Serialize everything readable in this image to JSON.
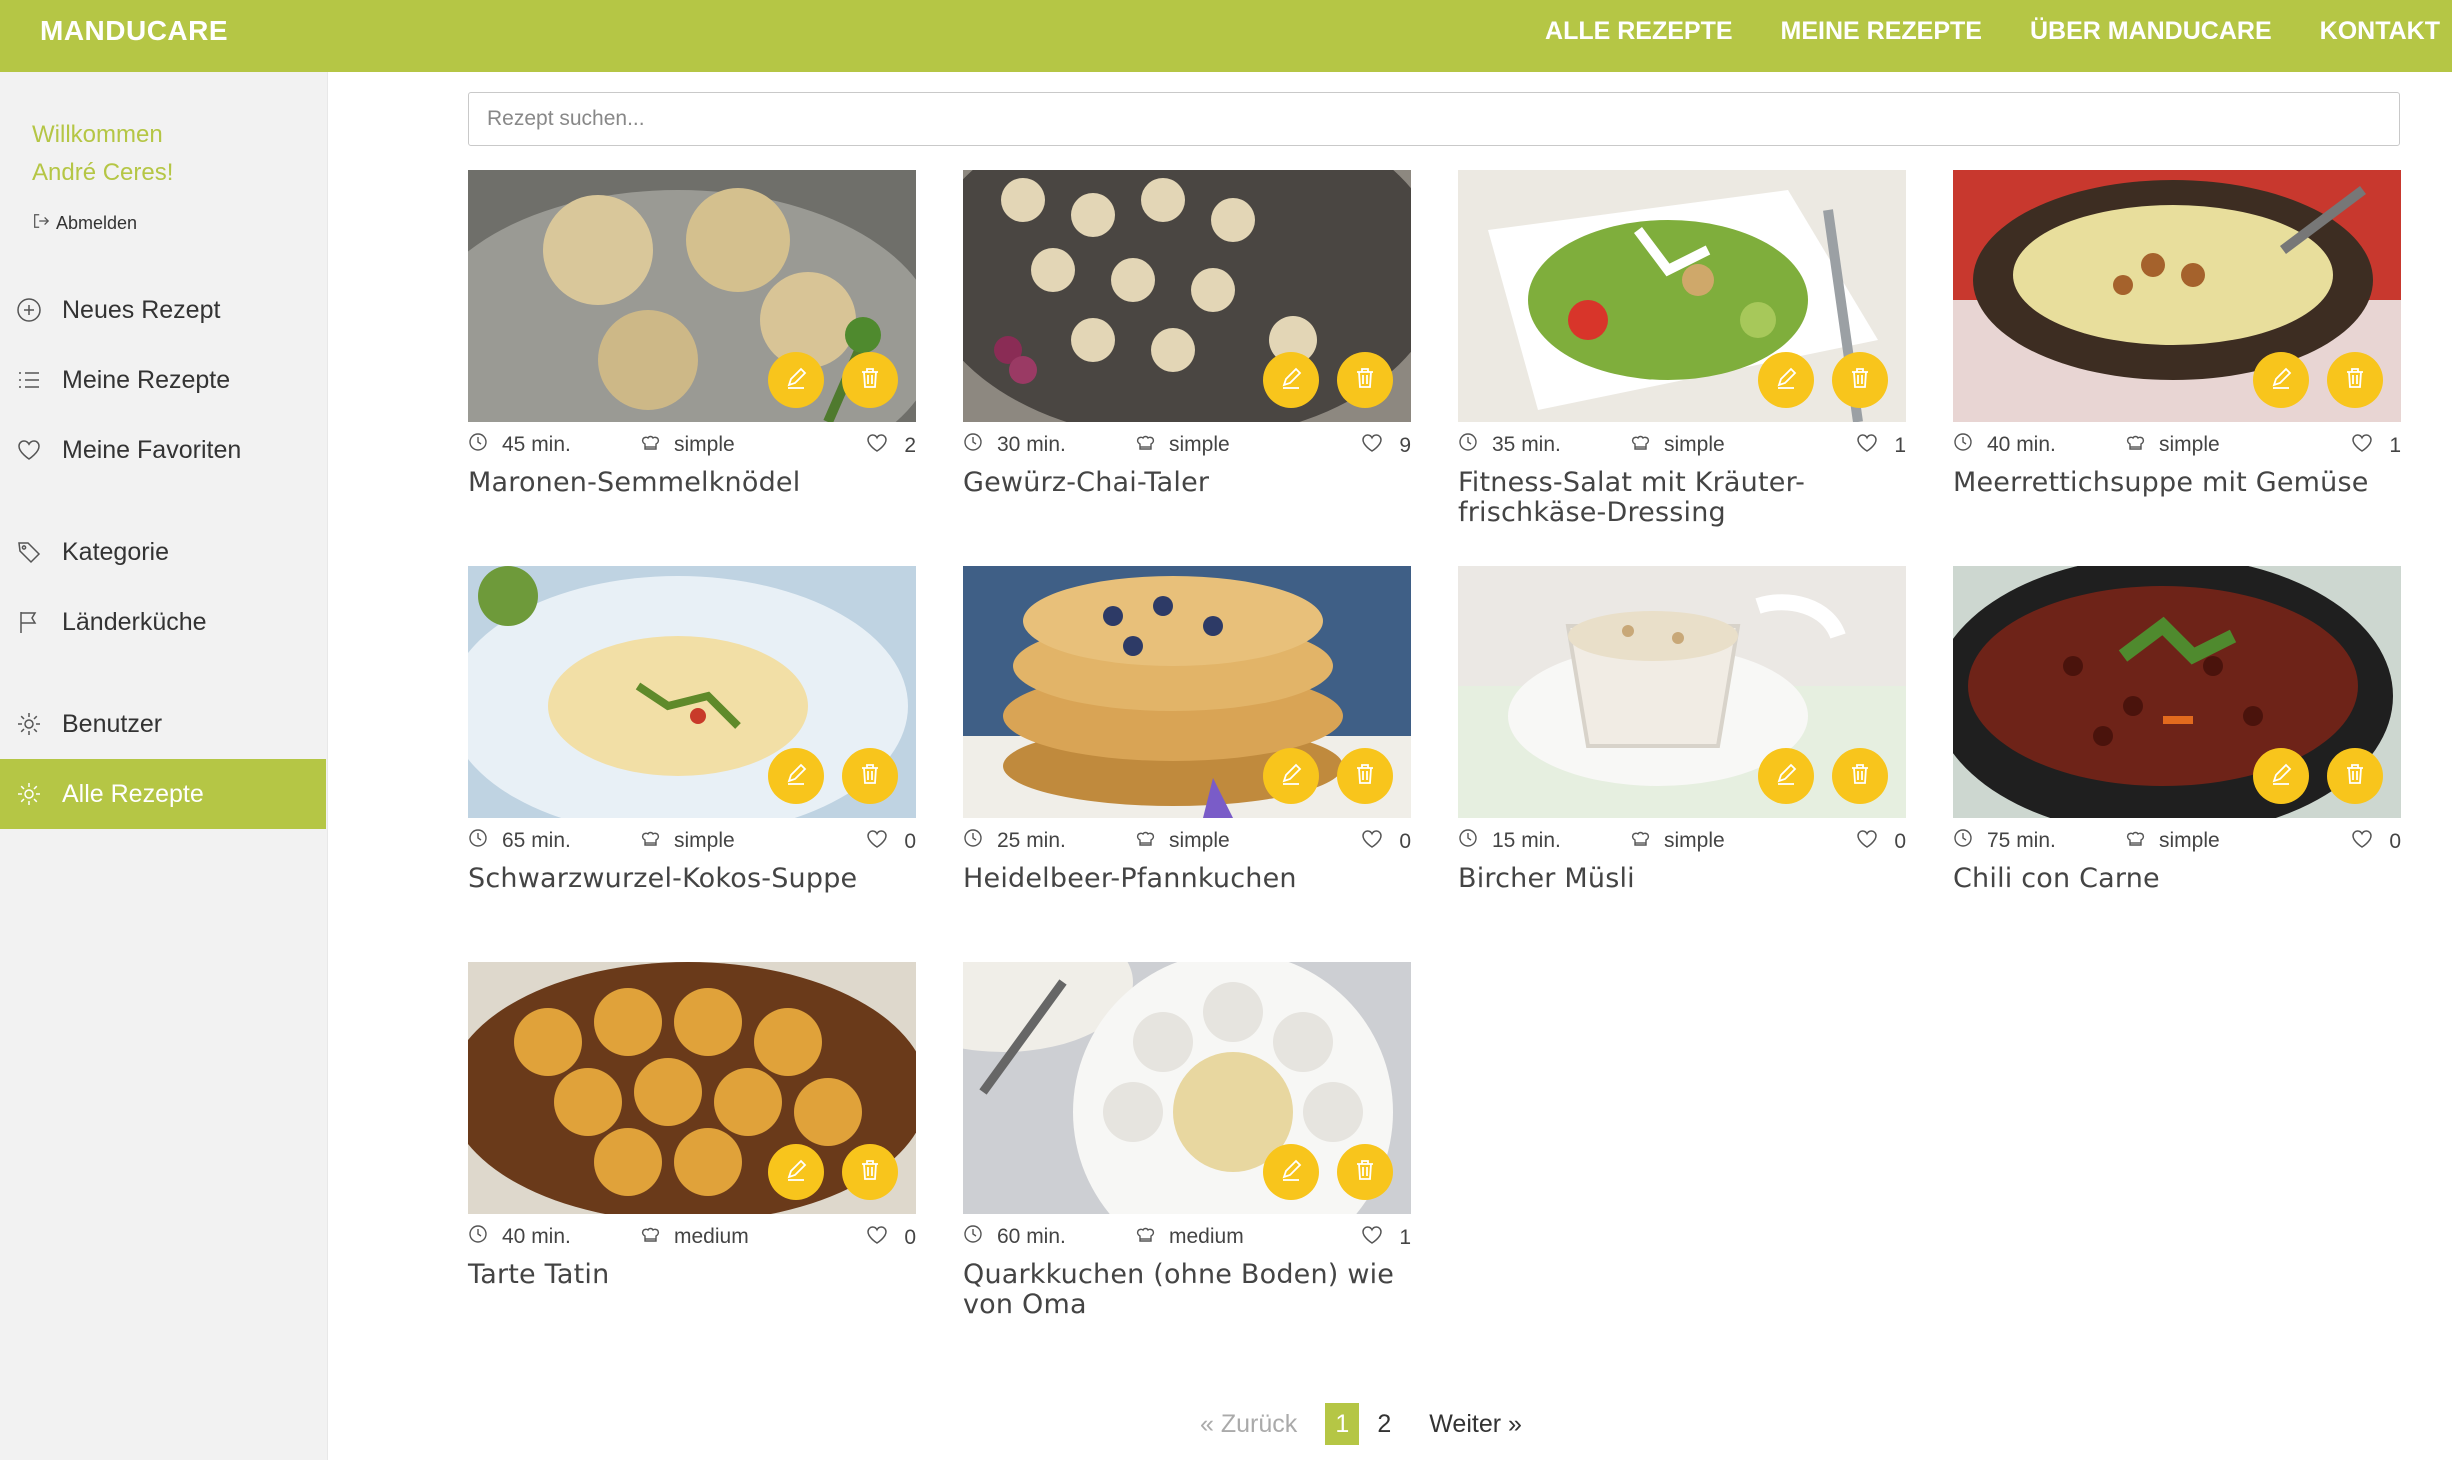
{
  "app": {
    "brand": "MANDUCARE"
  },
  "topnav": [
    {
      "label": "ALLE REZEPTE"
    },
    {
      "label": "MEINE REZEPTE"
    },
    {
      "label": "ÜBER MANDUCARE"
    },
    {
      "label": "KONTAKT"
    }
  ],
  "sidebar": {
    "welcome_line1": "Willkommen",
    "welcome_line2": "André Ceres!",
    "logout": "Abmelden",
    "items": [
      {
        "label": "Neues Rezept",
        "icon": "plus-circle-icon"
      },
      {
        "label": "Meine Rezepte",
        "icon": "list-icon"
      },
      {
        "label": "Meine Favoriten",
        "icon": "heart-icon"
      },
      {
        "label": "Kategorie",
        "icon": "tag-icon"
      },
      {
        "label": "Länderküche",
        "icon": "flag-icon"
      },
      {
        "label": "Benutzer",
        "icon": "gear-icon"
      },
      {
        "label": "Alle Rezepte",
        "icon": "gear-icon",
        "active": true
      }
    ]
  },
  "search": {
    "placeholder": "Rezept suchen..."
  },
  "recipes": [
    {
      "title": "Maronen-Semmelknödel",
      "time": "45 min.",
      "difficulty": "simple",
      "favorites": "2"
    },
    {
      "title": "Gewürz-Chai-Taler",
      "time": "30 min.",
      "difficulty": "simple",
      "favorites": "9"
    },
    {
      "title": "Fitness-Salat mit Kräuter-frischkäse-Dressing",
      "time": "35 min.",
      "difficulty": "simple",
      "favorites": "1"
    },
    {
      "title": "Meerrettichsuppe mit Gemüse",
      "time": "40 min.",
      "difficulty": "simple",
      "favorites": "1"
    },
    {
      "title": "Schwarzwurzel-Kokos-Suppe",
      "time": "65 min.",
      "difficulty": "simple",
      "favorites": "0"
    },
    {
      "title": "Heidelbeer-Pfannkuchen",
      "time": "25 min.",
      "difficulty": "simple",
      "favorites": "0"
    },
    {
      "title": "Bircher Müsli",
      "time": "15 min.",
      "difficulty": "simple",
      "favorites": "0"
    },
    {
      "title": "Chili con Carne",
      "time": "75 min.",
      "difficulty": "simple",
      "favorites": "0"
    },
    {
      "title": "Tarte Tatin",
      "time": "40 min.",
      "difficulty": "medium",
      "favorites": "0"
    },
    {
      "title": "Quarkkuchen (ohne Boden) wie von Oma",
      "time": "60 min.",
      "difficulty": "medium",
      "favorites": "1"
    }
  ],
  "pagination": {
    "prev": "«  Zurück",
    "pages": [
      "1",
      "2"
    ],
    "current": "1",
    "next": "Weiter  »"
  },
  "colors": {
    "accent": "#b5c645",
    "action": "#f8c51c"
  }
}
